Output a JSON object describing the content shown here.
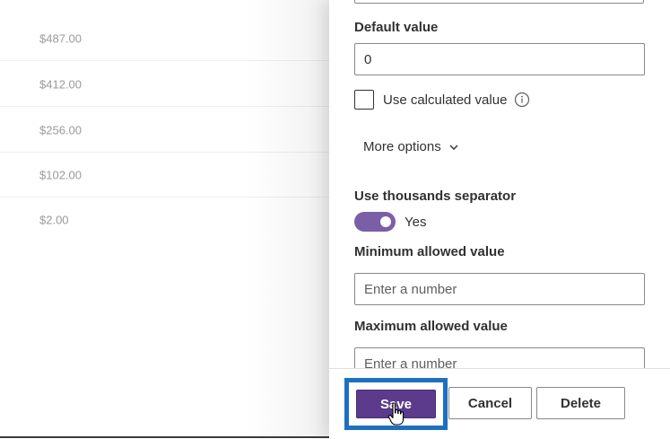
{
  "list": {
    "rows": [
      {
        "amount": "$487.00"
      },
      {
        "amount": "$412.00"
      },
      {
        "amount": "$256.00"
      },
      {
        "amount": "$102.00"
      },
      {
        "amount": "$2.00"
      }
    ]
  },
  "panel": {
    "default_value": {
      "label": "Default value",
      "value": "0"
    },
    "calculated": {
      "label": "Use calculated value",
      "checked": false,
      "icon": "info-icon"
    },
    "more_options": {
      "label": "More options",
      "icon": "chevron-down-icon"
    },
    "thousands": {
      "label": "Use thousands separator",
      "state_label": "Yes",
      "on": true
    },
    "minimum": {
      "label": "Minimum allowed value",
      "placeholder": "Enter a number"
    },
    "maximum": {
      "label": "Maximum allowed value",
      "placeholder": "Enter a number"
    }
  },
  "footer": {
    "save_label": "Save",
    "cancel_label": "Cancel",
    "delete_label": "Delete"
  },
  "colors": {
    "accent": "#5c3a8c",
    "toggle_on": "#7a5fa6",
    "highlight": "#1f6fc1"
  }
}
